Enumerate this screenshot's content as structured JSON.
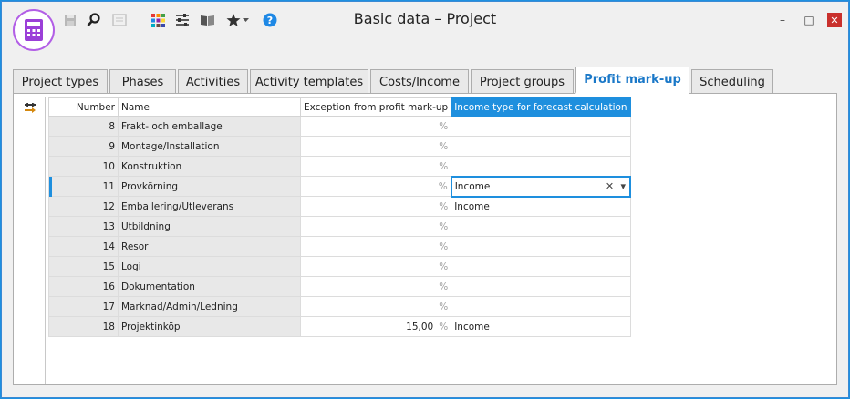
{
  "window": {
    "title": "Basic data – Project",
    "controls": {
      "minimize": "–",
      "maximize": "□",
      "close": "✕"
    }
  },
  "toolbar": {
    "icons": [
      "calculator-icon",
      "save-icon",
      "search-icon",
      "document-icon",
      "color-grid-icon",
      "sliders-icon",
      "book-icon",
      "star-icon",
      "help-icon"
    ]
  },
  "tabs": [
    {
      "label": "Project types",
      "active": false
    },
    {
      "label": "Phases",
      "active": false
    },
    {
      "label": "Activities",
      "active": false
    },
    {
      "label": "Activity templates",
      "active": false
    },
    {
      "label": "Costs/Income",
      "active": false
    },
    {
      "label": "Project groups",
      "active": false
    },
    {
      "label": "Profit mark-up",
      "active": true
    },
    {
      "label": "Scheduling",
      "active": false
    }
  ],
  "grid": {
    "columns": {
      "number": "Number",
      "name": "Name",
      "exception": "Exception from profit mark-up",
      "income_type": "Income type for forecast calculation"
    },
    "rows": [
      {
        "number": "8",
        "name": "Frakt- och emballage",
        "exception": "",
        "unit": "%",
        "income_type": ""
      },
      {
        "number": "9",
        "name": "Montage/Installation",
        "exception": "",
        "unit": "%",
        "income_type": ""
      },
      {
        "number": "10",
        "name": "Konstruktion",
        "exception": "",
        "unit": "%",
        "income_type": ""
      },
      {
        "number": "11",
        "name": "Provkörning",
        "exception": "",
        "unit": "%",
        "income_type": "Income"
      },
      {
        "number": "12",
        "name": "Emballering/Utleverans",
        "exception": "",
        "unit": "%",
        "income_type": "Income"
      },
      {
        "number": "13",
        "name": "Utbildning",
        "exception": "",
        "unit": "%",
        "income_type": ""
      },
      {
        "number": "14",
        "name": "Resor",
        "exception": "",
        "unit": "%",
        "income_type": ""
      },
      {
        "number": "15",
        "name": "Logi",
        "exception": "",
        "unit": "%",
        "income_type": ""
      },
      {
        "number": "16",
        "name": "Dokumentation",
        "exception": "",
        "unit": "%",
        "income_type": ""
      },
      {
        "number": "17",
        "name": "Marknad/Admin/Ledning",
        "exception": "",
        "unit": "%",
        "income_type": ""
      },
      {
        "number": "18",
        "name": "Projektinköp",
        "exception": "15,00",
        "unit": "%",
        "income_type": "Income"
      }
    ],
    "editing_row": 3,
    "edit_controls": {
      "clear": "✕",
      "dropdown": "▾"
    }
  },
  "colors": {
    "accent": "#1e8fde",
    "app_ring": "#b25ee6",
    "close": "#c9302c"
  }
}
